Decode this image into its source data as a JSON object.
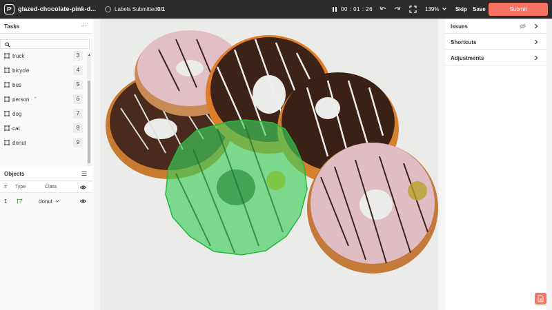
{
  "topbar": {
    "filename": "glazed-chocolate-pink-d...",
    "status_label": "Labels Submitted",
    "status_count": "0/1",
    "timer": "00 : 01 : 26",
    "zoom": "139%",
    "skip_label": "Skip",
    "save_label": "Save",
    "submit_label": "Submit"
  },
  "tasks": {
    "title": "Tasks",
    "items": [
      {
        "label": "truck",
        "key": "3",
        "required": false
      },
      {
        "label": "bicycle",
        "key": "4",
        "required": false
      },
      {
        "label": "bus",
        "key": "5",
        "required": false
      },
      {
        "label": "person",
        "key": "6",
        "required": true
      },
      {
        "label": "dog",
        "key": "7",
        "required": false
      },
      {
        "label": "cat",
        "key": "8",
        "required": false
      },
      {
        "label": "donut",
        "key": "9",
        "required": false
      }
    ],
    "required_mark": "*"
  },
  "objects": {
    "title": "Objects",
    "columns": {
      "num": "#",
      "type": "Type",
      "class": "Class"
    },
    "rows": [
      {
        "num": "1",
        "class": "donut"
      }
    ]
  },
  "right_panel": {
    "issues": "Issues",
    "shortcuts": "Shortcuts",
    "adjustments": "Adjustments"
  },
  "colors": {
    "accent": "#fa7161",
    "topbar": "#2b2b2b",
    "polygon": "#2ecc40"
  },
  "icons": [
    "logo-icon",
    "pause-icon",
    "undo-icon",
    "redo-icon",
    "fullscreen-icon",
    "chevron-down-icon",
    "search-icon",
    "polygon-icon",
    "eye-icon",
    "eye-off-icon",
    "chevron-right-icon",
    "document-icon"
  ]
}
